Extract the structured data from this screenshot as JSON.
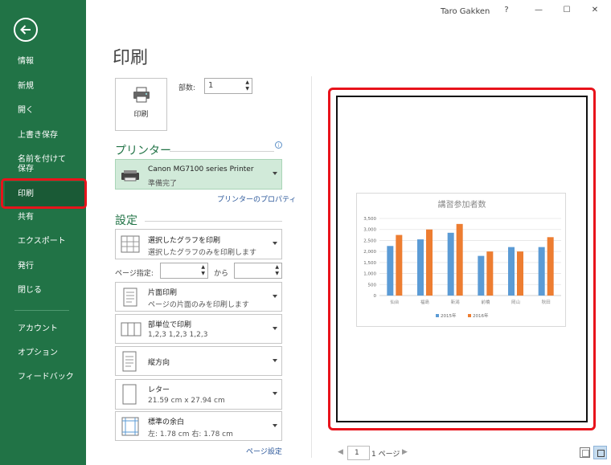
{
  "window": {
    "user": "Taro Gakken",
    "help": "?",
    "minimize": "—",
    "maximize": "☐",
    "close": "✕"
  },
  "sidebar": {
    "items": [
      "情報",
      "新規",
      "開く",
      "上書き保存",
      "名前を付けて保存",
      "印刷",
      "共有",
      "エクスポート",
      "発行",
      "閉じる",
      "アカウント",
      "オプション",
      "フィードバック"
    ]
  },
  "main": {
    "title": "印刷",
    "print_button": "印刷",
    "copies_label": "部数:",
    "copies_value": "1",
    "printer_section": "プリンター",
    "printer_name": "Canon MG7100 series Printer",
    "printer_status": "準備完了",
    "printer_properties": "プリンターのプロパティ",
    "settings_section": "設定",
    "settings": [
      {
        "title": "選択したグラフを印刷",
        "detail": "選択したグラフのみを印刷します"
      },
      {
        "title": "片面印刷",
        "detail": "ページの片面のみを印刷します"
      },
      {
        "title": "部単位で印刷",
        "detail": "1,2,3    1,2,3    1,2,3"
      },
      {
        "title": "縦方向",
        "detail": ""
      },
      {
        "title": "レター",
        "detail": "21.59 cm x 27.94 cm"
      },
      {
        "title": "標準の余白",
        "detail": "左:  1.78 cm    右:  1.78 cm"
      }
    ],
    "pages_label": "ページ指定:",
    "pages_to": "から",
    "page_setup": "ページ設定"
  },
  "preview": {
    "page_number": "1",
    "page_total": "1 ページ"
  },
  "chart_data": {
    "type": "bar",
    "title": "講習参加者数",
    "categories": [
      "仙台",
      "福島",
      "新潟",
      "前橋",
      "岡山",
      "秋田"
    ],
    "series": [
      {
        "name": "2015年",
        "color": "#5b9bd5",
        "values": [
          2250,
          2550,
          2850,
          1800,
          2200,
          2200
        ]
      },
      {
        "name": "2016年",
        "color": "#ed7d31",
        "values": [
          2750,
          3000,
          3250,
          2000,
          2000,
          2650
        ]
      }
    ],
    "yticks": [
      "0",
      "500",
      "1,000",
      "1,500",
      "2,000",
      "2,500",
      "3,000",
      "3,500"
    ],
    "ylim": [
      0,
      3500
    ],
    "grid": true,
    "legend": "bottom"
  }
}
